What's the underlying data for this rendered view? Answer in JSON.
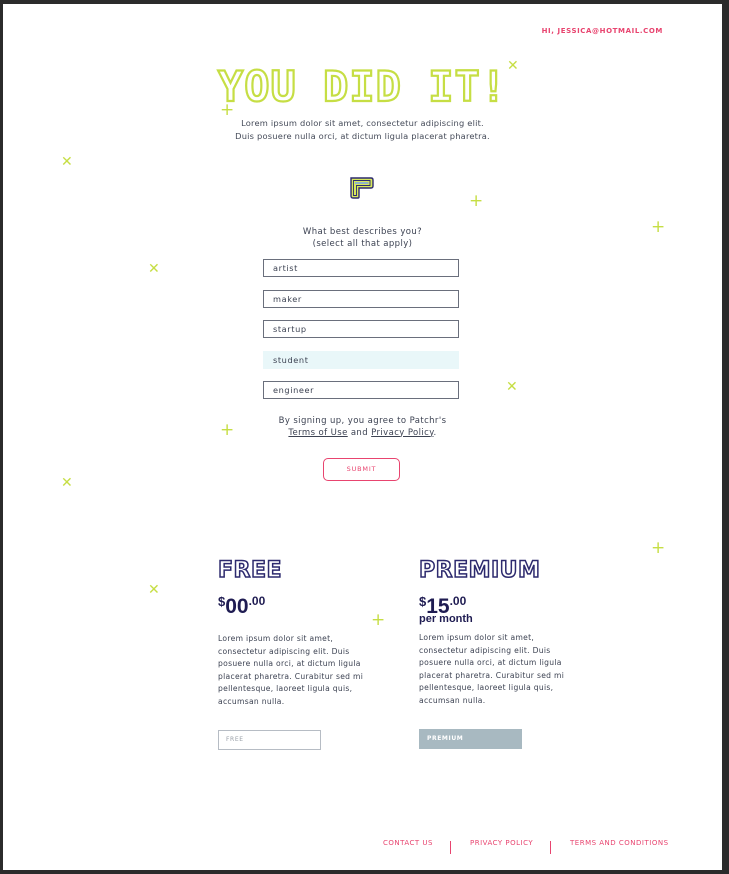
{
  "header": {
    "user_email": "HI, JESSICA@HOTMAIL.COM"
  },
  "hero": {
    "title": "YOU DID IT!",
    "subtitle_line1": "Lorem ipsum dolor sit amet, consectetur adipiscing elit.",
    "subtitle_line2": "Duis posuere nulla orci, at dictum ligula placerat pharetra."
  },
  "question": {
    "line1": "What best describes you?",
    "line2": "(select all that apply)"
  },
  "options": [
    {
      "label": "artist",
      "selected": false
    },
    {
      "label": "maker",
      "selected": false
    },
    {
      "label": "startup",
      "selected": false
    },
    {
      "label": "student",
      "selected": true
    },
    {
      "label": "engineer",
      "selected": false
    }
  ],
  "terms": {
    "prefix": "By signing up, you agree to Patchr's",
    "terms_link": "Terms of Use",
    "and": "and",
    "privacy_link": "Privacy Policy",
    "suffix": "."
  },
  "submit_label": "SUBMIT",
  "plans": {
    "free": {
      "title": "FREE",
      "currency": "$",
      "amount": "00",
      "cents": ".00",
      "per": "",
      "description": "Lorem ipsum dolor sit amet, consectetur adipiscing elit. Duis posuere nulla orci, at dictum ligula placerat pharetra. Curabitur sed mi pellentesque, laoreet ligula quis, accumsan nulla.",
      "button": "FREE"
    },
    "premium": {
      "title": "PREMIUM",
      "currency": "$",
      "amount": "15",
      "cents": ".00",
      "per": "per month",
      "description": "Lorem ipsum dolor sit amet, consectetur adipiscing elit. Duis posuere nulla orci, at dictum ligula placerat pharetra. Curabitur sed mi pellentesque, laoreet ligula quis, accumsan nulla.",
      "button": "PREMIUM"
    }
  },
  "footer": {
    "contact": "CONTACT US",
    "privacy": "PRIVACY POLICY",
    "terms": "TERMS AND CONDITIONS"
  },
  "colors": {
    "accent_pink": "#e8446f",
    "lime": "#c6de44",
    "navy": "#2d2a6e",
    "selected_bg": "#e9f7f9"
  },
  "icons": {
    "logo": "patchr-logo-icon",
    "plus": "plus-icon",
    "cross": "cross-icon"
  }
}
